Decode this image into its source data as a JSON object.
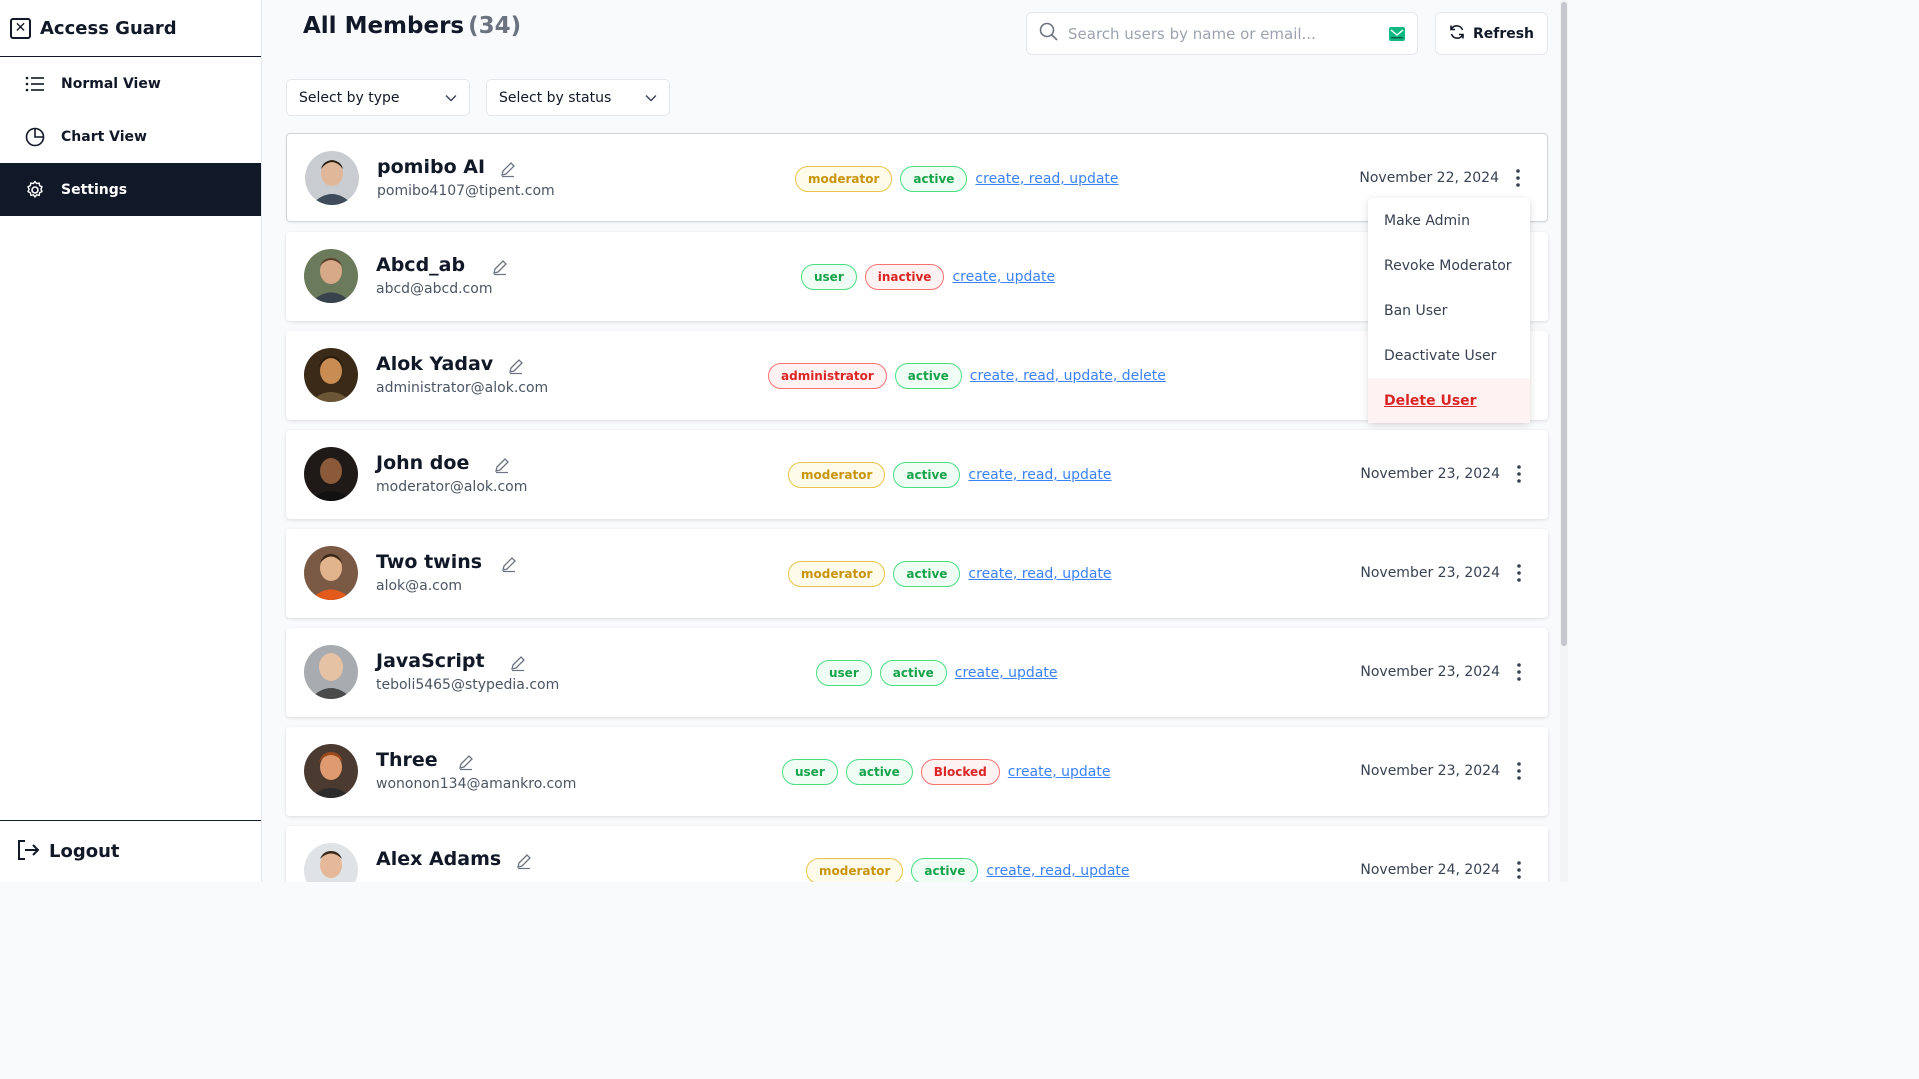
{
  "app": {
    "title": "Access Guard",
    "logo_icon": "x-box-icon"
  },
  "sidebar": {
    "items": [
      {
        "label": "Normal View",
        "icon": "list-icon",
        "active": false
      },
      {
        "label": "Chart View",
        "icon": "pie-chart-icon",
        "active": false
      },
      {
        "label": "Settings",
        "icon": "gear-icon",
        "active": true
      }
    ],
    "logout_label": "Logout"
  },
  "header": {
    "title": "All Members",
    "count": "(34)",
    "search_placeholder": "Search users by name or email...",
    "search_value": "",
    "refresh_label": "Refresh"
  },
  "filters": {
    "type_label": "Select by type",
    "status_label": "Select by status"
  },
  "members": [
    {
      "name": "pomibo AI",
      "email": "pomibo4107@tipent.com",
      "role": "moderator",
      "status": "active",
      "extra_badge": "",
      "permissions": "create, read, update",
      "date": "November 22, 2024"
    },
    {
      "name": "Abcd_ab",
      "email": "abcd@abcd.com",
      "role": "user",
      "status": "inactive",
      "extra_badge": "",
      "permissions": "create, update",
      "date": ""
    },
    {
      "name": "Alok Yadav",
      "email": "administrator@alok.com",
      "role": "administrator",
      "status": "active",
      "extra_badge": "",
      "permissions": "create, read, update, delete",
      "date": ""
    },
    {
      "name": "John doe",
      "email": "moderator@alok.com",
      "role": "moderator",
      "status": "active",
      "extra_badge": "",
      "permissions": "create, read, update",
      "date": "November 23, 2024"
    },
    {
      "name": "Two twins",
      "email": "alok@a.com",
      "role": "moderator",
      "status": "active",
      "extra_badge": "",
      "permissions": "create, read, update",
      "date": "November 23, 2024"
    },
    {
      "name": "JavaScript",
      "email": "teboli5465@stypedia.com",
      "role": "user",
      "status": "active",
      "extra_badge": "",
      "permissions": "create, update",
      "date": "November 23, 2024"
    },
    {
      "name": "Three",
      "email": "wononon134@amankro.com",
      "role": "user",
      "status": "active",
      "extra_badge": "Blocked",
      "permissions": "create, update",
      "date": "November 23, 2024"
    },
    {
      "name": "Alex Adams",
      "email": "",
      "role": "moderator",
      "status": "active",
      "extra_badge": "",
      "permissions": "create, read, update",
      "date": "November 24, 2024"
    }
  ],
  "context_menu": {
    "items": [
      "Make Admin",
      "Revoke Moderator",
      "Ban User",
      "Deactivate User",
      "Delete User"
    ]
  },
  "colors": {
    "sidebar_active_bg": "#111827",
    "moderator": "#c8940c",
    "active": "#16a34a",
    "danger": "#dc2626",
    "link": "#3b82f6"
  }
}
